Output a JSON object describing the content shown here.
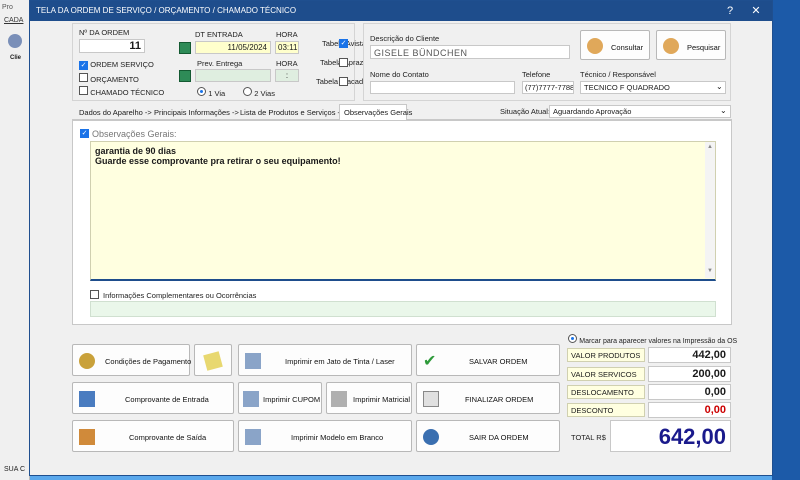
{
  "window": {
    "title": "TELA DA ORDEM DE SERVIÇO / ORÇAMENTO / CHAMADO TÉCNICO",
    "help": "?",
    "close": "✕"
  },
  "bg_app": {
    "menu_fragment": "CADA",
    "side_label": "Clie",
    "status_fragment": "SUA C",
    "title_fragment": "Pro"
  },
  "order": {
    "number_label": "Nº DA ORDEM",
    "number_value": "11",
    "types": [
      {
        "label": "ORDEM SERVIÇO",
        "checked": true
      },
      {
        "label": "ORÇAMENTO",
        "checked": false
      },
      {
        "label": "CHAMADO TÉCNICO",
        "checked": false
      }
    ]
  },
  "dates": {
    "entry_label": "DT ENTRADA",
    "entry_value": "11/05/2024",
    "hour_label": "HORA",
    "hour_value": "03:11",
    "forecast_label": "Prev. Entrega",
    "forecast_value": "",
    "hour2_label": "HORA",
    "hour2_value": ":",
    "via1": "1 Via",
    "via2": "2 Vias"
  },
  "price_tables": [
    {
      "label": "Tabela Avista",
      "checked": true
    },
    {
      "label": "Tabela Aprazo",
      "checked": false
    },
    {
      "label": "Tabela Atacado",
      "checked": false
    }
  ],
  "client": {
    "desc_label": "Descrição do Cliente",
    "desc_value": "GISELE BÜNDCHEN",
    "btn_consult": "Consultar",
    "btn_search": "Pesquisar",
    "contact_label": "Nome do Contato",
    "contact_value": "",
    "phone_label": "Telefone",
    "phone_value": "(77)7777-7788",
    "tech_label": "Técnico / Responsável",
    "tech_value": "TECNICO F QUADRADO"
  },
  "tabs": [
    {
      "label": "Dados do Aparelho ->"
    },
    {
      "label": "Principais Informações ->"
    },
    {
      "label": "Lista de Produtos e Serviços ->"
    },
    {
      "label": "Observações Gerais"
    }
  ],
  "status": {
    "label": "Situação Atual:",
    "value": "Aguardando Aprovação"
  },
  "observations": {
    "title": "Observações Gerais:",
    "line1": "garantia de 90 dias",
    "line2": "Guarde esse comprovante pra retirar o seu equipamento!",
    "complement_label": "Informações Complementares ou Ocorrências"
  },
  "buttons": {
    "payment": "Condições de Pagamento",
    "entry_receipt": "Comprovante de Entrada",
    "exit_receipt": "Comprovante de Saída",
    "print_inkjet": "Imprimir em Jato de Tinta / Laser",
    "print_coupon": "Imprimir CUPOM",
    "print_matrix": "Imprimir Matricial",
    "print_blank": "Imprimir Modelo em Branco",
    "save": "SALVAR ORDEM",
    "finish": "FINALIZAR ORDEM",
    "exit": "SAIR DA ORDEM"
  },
  "totals": {
    "mark_label": "Marcar para aparecer valores na Impressão da OS",
    "products_label": "VALOR PRODUTOS",
    "products_value": "442,00",
    "services_label": "VALOR SERVICOS",
    "services_value": "200,00",
    "travel_label": "DESLOCAMENTO",
    "travel_value": "0,00",
    "discount_label": "DESCONTO",
    "discount_value": "0,00",
    "total_label": "TOTAL R$",
    "total_value": "642,00"
  },
  "colors": {
    "titlebar": "#1e4d8c",
    "obs_bg": "#ffffe0",
    "total": "#1a1a8c",
    "discount": "#cc0000",
    "accent": "#1a73e8"
  }
}
